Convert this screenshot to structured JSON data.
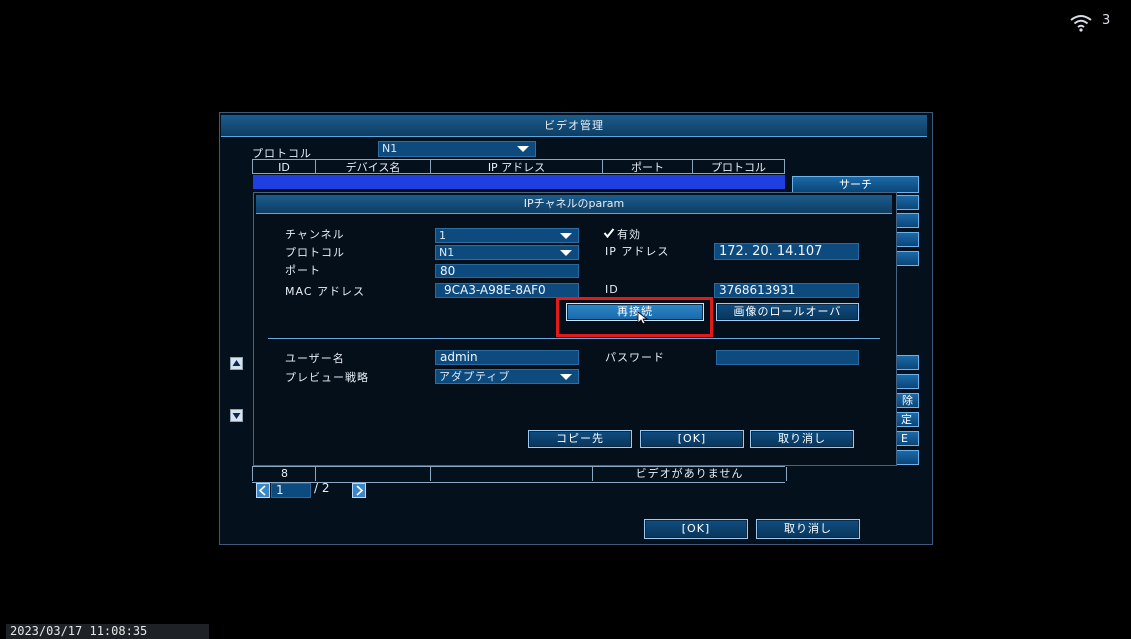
{
  "status": {
    "wifi_icon": "wifi-icon",
    "wifi_count": "3"
  },
  "timestamp": "2023/03/17 11:08:35",
  "video_manager": {
    "title": "ビデオ管理",
    "protocol_label": "プロトコル",
    "protocol_value": "N1",
    "columns": [
      "ID",
      "デバイス名",
      "IP アドレス",
      "ポート",
      "プロトコル"
    ],
    "search_button": "サーチ",
    "row_8": {
      "id": "8",
      "status": "ビデオがありません"
    },
    "page_current": "1",
    "page_total": "/ 2",
    "ok_button": "[OK]",
    "cancel_button": "取り消し",
    "side_fragments": [
      "除",
      "定",
      "E"
    ]
  },
  "dialog": {
    "title": "IPチャネルのparam",
    "channel_label": "チャンネル",
    "channel_value": "1",
    "enabled_label": "有効",
    "enabled_checked": true,
    "protocol_label": "プロトコル",
    "protocol_value": "N1",
    "ip_label": "IP アドレス",
    "ip_value": "172. 20. 14.107",
    "port_label": "ポート",
    "port_value": "80",
    "mac_label": "MAC アドレス",
    "mac_value": "9CA3-A98E-8AF0",
    "id_label": "ID",
    "id_value": "3768613931",
    "reconnect_button": "再接続",
    "rollover_button": "画像のロールオーバ",
    "username_label": "ユーザー名",
    "username_value": "admin",
    "password_label": "パスワード",
    "password_value": "",
    "preview_label": "プレビュー戦略",
    "preview_value": "アダプティブ",
    "copy_button": "コピー先",
    "ok_button": "[OK]",
    "cancel_button": "取り消し"
  }
}
